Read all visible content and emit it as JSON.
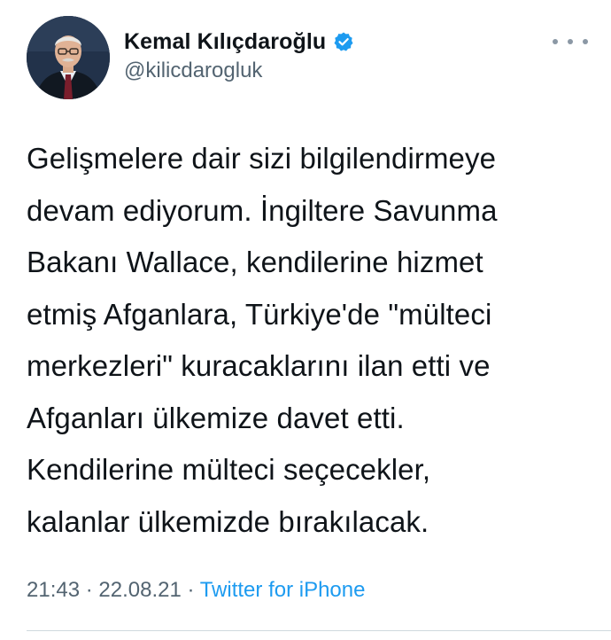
{
  "author": {
    "display_name": "Kemal Kılıçdaroğlu",
    "handle": "@kilicdarogluk",
    "verified": true,
    "avatar_icon": "profile-photo"
  },
  "tweet": {
    "lines": [
      "Gelişmelere dair sizi bilgilendirmeye",
      "devam ediyorum. İngiltere Savunma",
      "Bakanı Wallace, kendilerine hizmet",
      "etmiş Afganlara, Türkiye'de \"mülteci",
      "merkezleri\" kuracaklarını ilan etti ve",
      "Afganları ülkemize davet etti.",
      "Kendilerine mülteci seçecekler,",
      "kalanlar ülkemizde bırakılacak."
    ]
  },
  "meta": {
    "time": "21:43",
    "separator": " · ",
    "date": "22.08.21",
    "source": "Twitter for iPhone"
  },
  "colors": {
    "text": "#0f1419",
    "secondary": "#536471",
    "link": "#1d9bf0",
    "verified": "#1d9bf0"
  },
  "icons": {
    "more": "more-horizontal-icon",
    "verified": "verified-badge-icon"
  }
}
